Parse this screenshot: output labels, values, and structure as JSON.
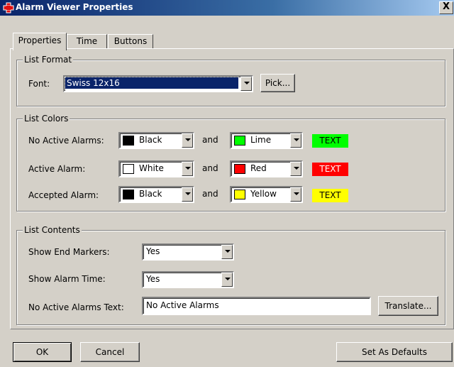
{
  "window": {
    "title": "Alarm Viewer Properties",
    "close_label": "X"
  },
  "tabs": [
    {
      "label": "Properties"
    },
    {
      "label": "Time"
    },
    {
      "label": "Buttons"
    }
  ],
  "list_format": {
    "legend": "List Format",
    "font_label": "Font:",
    "font_value": "Swiss 12x16",
    "pick_label": "Pick..."
  },
  "list_colors": {
    "legend": "List Colors",
    "and_label": "and",
    "rows": [
      {
        "label": "No Active Alarms:",
        "fg": {
          "name": "Black",
          "hex": "#000000"
        },
        "bg": {
          "name": "Lime",
          "hex": "#00ff00"
        },
        "preview": "TEXT",
        "preview_fg": "#000000",
        "preview_bg": "#00ff00"
      },
      {
        "label": "Active Alarm:",
        "fg": {
          "name": "White",
          "hex": "#ffffff"
        },
        "bg": {
          "name": "Red",
          "hex": "#ff0000"
        },
        "preview": "TEXT",
        "preview_fg": "#ffffff",
        "preview_bg": "#ff0000"
      },
      {
        "label": "Accepted Alarm:",
        "fg": {
          "name": "Black",
          "hex": "#000000"
        },
        "bg": {
          "name": "Yellow",
          "hex": "#ffff00"
        },
        "preview": "TEXT",
        "preview_fg": "#000000",
        "preview_bg": "#ffff00"
      }
    ]
  },
  "list_contents": {
    "legend": "List Contents",
    "show_end_markers_label": "Show End Markers:",
    "show_end_markers_value": "Yes",
    "show_alarm_time_label": "Show Alarm Time:",
    "show_alarm_time_value": "Yes",
    "no_active_text_label": "No Active Alarms Text:",
    "no_active_text_value": "No Active Alarms",
    "translate_label": "Translate..."
  },
  "footer": {
    "ok_label": "OK",
    "cancel_label": "Cancel",
    "defaults_label": "Set As Defaults"
  }
}
